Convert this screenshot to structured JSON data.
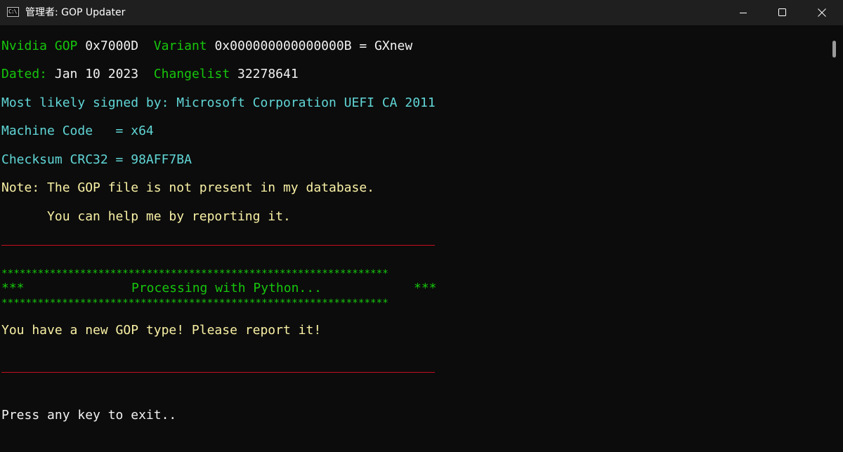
{
  "window": {
    "title": "管理者: GOP Updater",
    "icon_text": "C:\\",
    "icons": {
      "app": "console-icon",
      "minimize": "minimize-icon",
      "maximize": "maximize-icon",
      "close": "close-icon"
    }
  },
  "colors": {
    "background": "#0c0c0c",
    "titlebar": "#1f1f1f",
    "green": "#16c60c",
    "white": "#f2f2f2",
    "cyan": "#61d6d6",
    "yellow": "#f9f1a5",
    "red": "#c50f1f"
  },
  "console": {
    "line1": {
      "nvidia_label": "Nvidia GOP",
      "gop_value": "0x7000D",
      "variant_label": "Variant",
      "variant_value": "0x000000000000000B = GXnew"
    },
    "line2": {
      "dated_label": "Dated:",
      "dated_value": "Jan 10 2023",
      "changelist_label": "Changelist",
      "changelist_value": "32278641"
    },
    "signed_by": "Most likely signed by: Microsoft Corporation UEFI CA 2011",
    "machine_code": "Machine Code   = x64",
    "checksum": "Checksum CRC32 = 98AFF7BA",
    "note_line1": "Note: The GOP file is not present in my database.",
    "note_line2": "      You can help me by reporting it.",
    "stars_line": "****************************************************************",
    "processing_left": "***",
    "processing_text": "Processing with Python...",
    "processing_right": "***",
    "new_gop": "You have a new GOP type! Please report it!",
    "press_key": "Press any key to exit.."
  }
}
